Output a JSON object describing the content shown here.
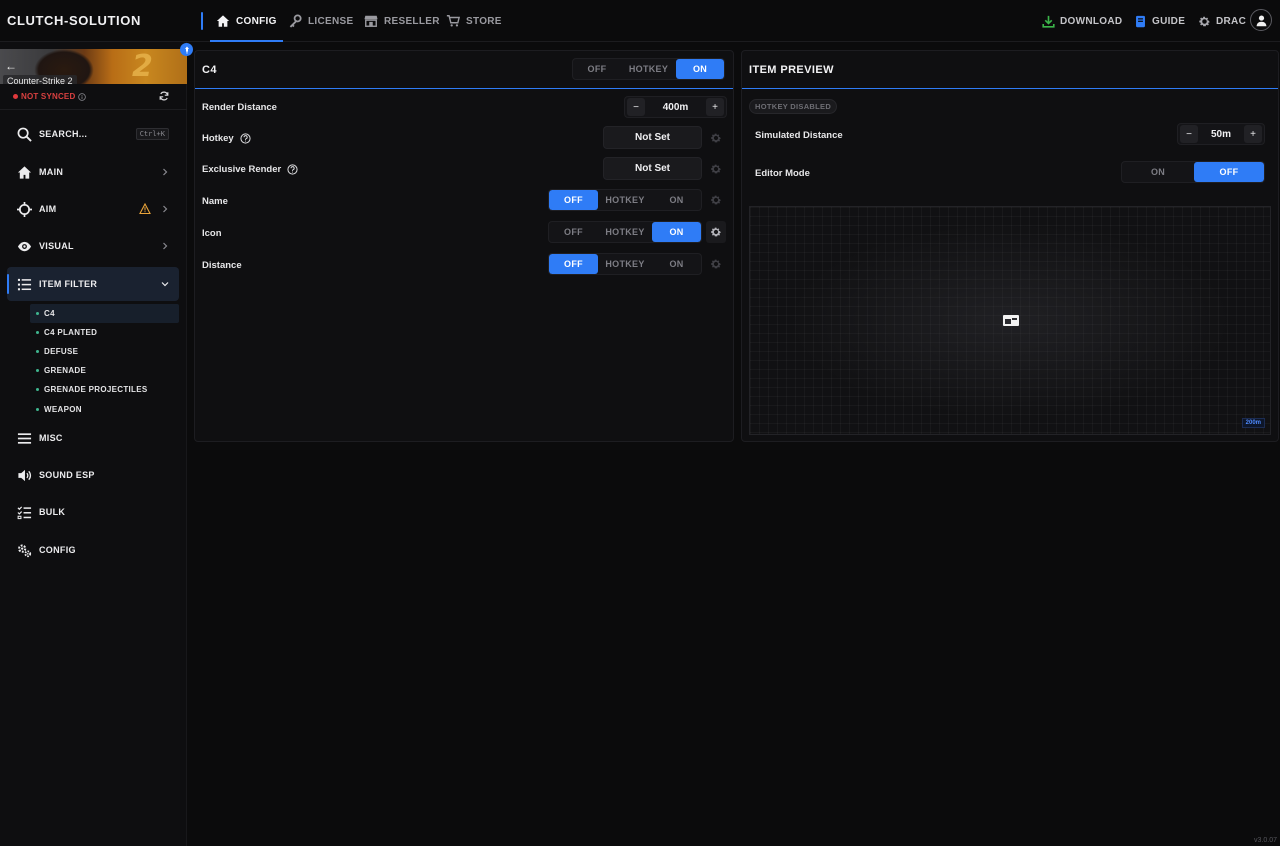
{
  "app": {
    "brand": "CLUTCH-SOLUTION",
    "version": "v3.0.07"
  },
  "topnav": {
    "tabs": [
      {
        "label": "CONFIG",
        "icon": "home-icon",
        "active": true
      },
      {
        "label": "LICENSE",
        "icon": "key-icon",
        "active": false
      },
      {
        "label": "RESELLER",
        "icon": "store-icon",
        "active": false
      },
      {
        "label": "STORE",
        "icon": "cart-icon",
        "active": false
      }
    ],
    "download": "DOWNLOAD",
    "guide": "GUIDE",
    "user": "DRAC"
  },
  "sidebar": {
    "game": "Counter-Strike 2",
    "sync_status": "NOT SYNCED",
    "search": {
      "label": "SEARCH...",
      "shortcut": "Ctrl+K"
    },
    "items": [
      {
        "label": "MAIN",
        "icon": "home-icon"
      },
      {
        "label": "AIM",
        "icon": "crosshair-icon",
        "warning": true
      },
      {
        "label": "VISUAL",
        "icon": "eye-icon"
      },
      {
        "label": "ITEM FILTER",
        "icon": "list-icon",
        "active": true,
        "expanded": true
      },
      {
        "label": "MISC",
        "icon": "menu-icon"
      },
      {
        "label": "SOUND ESP",
        "icon": "speaker-icon"
      },
      {
        "label": "BULK",
        "icon": "checklist-icon"
      },
      {
        "label": "CONFIG",
        "icon": "gears-icon"
      }
    ],
    "subitems": [
      "C4",
      "C4 PLANTED",
      "DEFUSE",
      "GRENADE",
      "GRENADE PROJECTILES",
      "WEAPON"
    ]
  },
  "c4_panel": {
    "title": "C4",
    "master_toggle": {
      "options": [
        "OFF",
        "HOTKEY",
        "ON"
      ],
      "selected": "ON"
    },
    "render_distance": {
      "label": "Render Distance",
      "value": "400m"
    },
    "hotkey": {
      "label": "Hotkey",
      "value": "Not Set"
    },
    "exclusive_render": {
      "label": "Exclusive Render",
      "value": "Not Set"
    },
    "name": {
      "label": "Name",
      "options": [
        "OFF",
        "HOTKEY",
        "ON"
      ],
      "selected": "OFF"
    },
    "icon": {
      "label": "Icon",
      "options": [
        "OFF",
        "HOTKEY",
        "ON"
      ],
      "selected": "ON"
    },
    "distance": {
      "label": "Distance",
      "options": [
        "OFF",
        "HOTKEY",
        "ON"
      ],
      "selected": "OFF"
    }
  },
  "preview_panel": {
    "title": "ITEM PREVIEW",
    "badge": "HOTKEY DISABLED",
    "simulated_distance": {
      "label": "Simulated Distance",
      "value": "50m"
    },
    "editor_mode": {
      "label": "Editor Mode",
      "options": [
        "ON",
        "OFF"
      ],
      "selected": "OFF"
    },
    "distance_tag": "200m"
  },
  "colors": {
    "accent": "#2f7cf6",
    "danger": "#e0393c",
    "warn": "#e8a33a",
    "download": "#3bb54a"
  }
}
